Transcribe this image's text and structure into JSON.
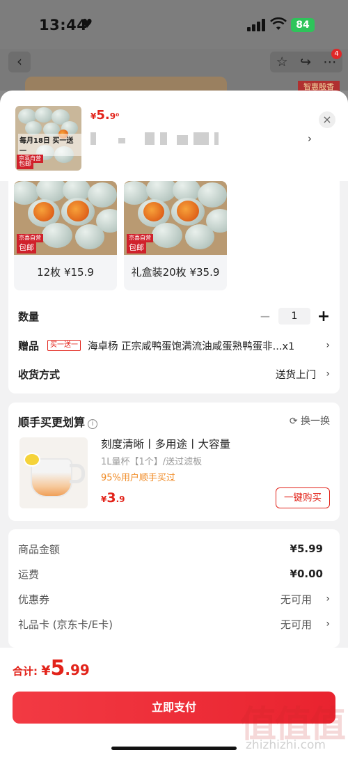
{
  "status_bar": {
    "time": "13:44",
    "battery": "84"
  },
  "background": {
    "badge": "智惠殷香",
    "notif_count": "4"
  },
  "sheet_header": {
    "price_currency": "¥",
    "price_int": "5.",
    "price_dec": "9⁰",
    "thumb_caption": "每月18日 买一送一",
    "tag_jd": "京喜自营",
    "tag_baoyou": "包邮"
  },
  "variants": [
    {
      "label": "12枚 ¥15.9",
      "tag_jd": "京喜自营",
      "tag_baoyou": "包邮"
    },
    {
      "label": "礼盒装20枚 ¥35.9",
      "tag_jd": "京喜自营",
      "tag_baoyou": "包邮"
    }
  ],
  "quantity": {
    "label": "数量",
    "minus": "−",
    "value": "1",
    "plus": "+"
  },
  "gift": {
    "label": "赠品",
    "tag": "买一送一",
    "text": "海卓杨 正宗咸鸭蛋饱满流油咸蛋熟鸭蛋非...x1"
  },
  "shipping": {
    "label": "收货方式",
    "value": "送货上门"
  },
  "addon": {
    "title": "顺手买更划算",
    "swap": "换一换",
    "product_title": "刻度清晰丨多用途丨大容量",
    "product_sub": "1L量杯【1个】/送过滤板",
    "product_pct": "95%用户顺手买过",
    "price_currency": "¥",
    "price_int": "3",
    "price_dec": ".9",
    "buy_label": "一键购买"
  },
  "summary": {
    "rows": [
      {
        "label": "商品金额",
        "value": "¥5.99"
      },
      {
        "label": "运费",
        "value": "¥0.00"
      },
      {
        "label": "优惠券",
        "value": "无可用"
      },
      {
        "label": "礼品卡 (京东卡/E卡)",
        "value": "无可用"
      }
    ]
  },
  "footer": {
    "total_label": "合计:",
    "total_currency": "¥",
    "total_int": "5",
    "total_dec": ".99",
    "pay_label": "立即支付"
  },
  "watermark": {
    "brand": "值值值",
    "site": "zhizhizhi.com"
  },
  "colors": {
    "accent": "#e2231a",
    "pay_button": "#ef2d38",
    "addon_pct": "#f08a24"
  }
}
